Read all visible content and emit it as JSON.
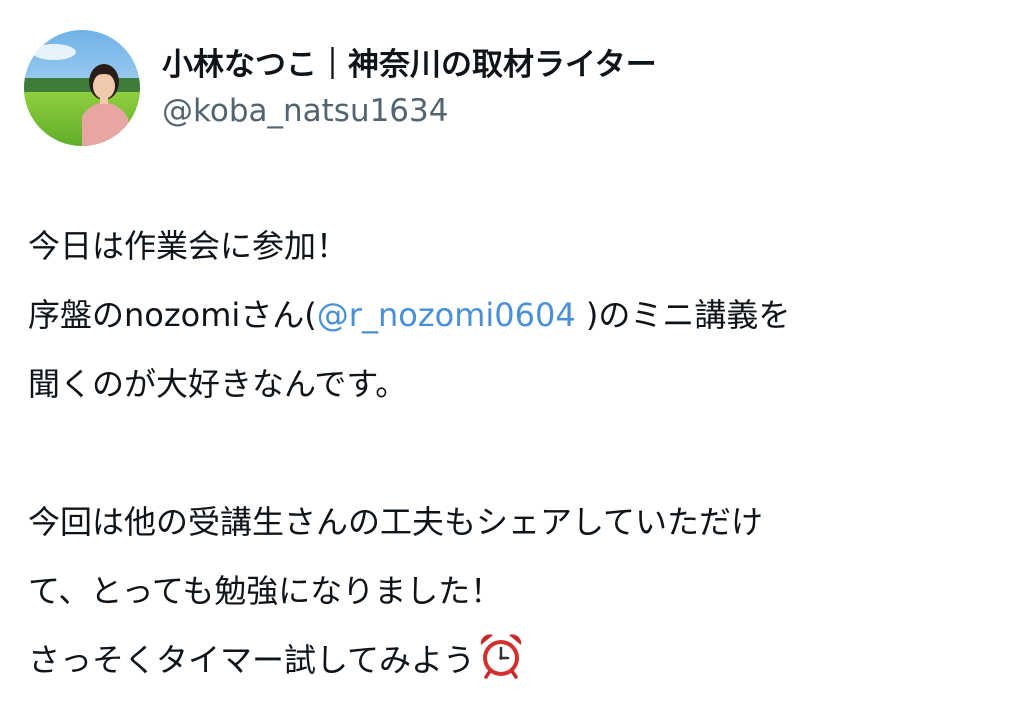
{
  "user": {
    "display_name": "小林なつこ｜神奈川の取材ライター",
    "handle": "@koba_natsu1634",
    "avatar_icon": "profile-photo"
  },
  "tweet": {
    "line1": "今日は作業会に参加！",
    "line2_pre": "序盤のnozomiさん(",
    "line2_mention": "@r_nozomi0604",
    "line2_post": " )のミニ講義を",
    "line3": "聞くのが大好きなんです。",
    "line4": "今回は他の受講生さんの工夫もシェアしていただけ",
    "line5": "て、とっても勉強になりました！",
    "line6": "さっそくタイマー試してみよう",
    "line6_emoji": "alarm-clock-icon"
  },
  "colors": {
    "text": "#0f1419",
    "secondary": "#536471",
    "mention": "#4a90d9"
  }
}
